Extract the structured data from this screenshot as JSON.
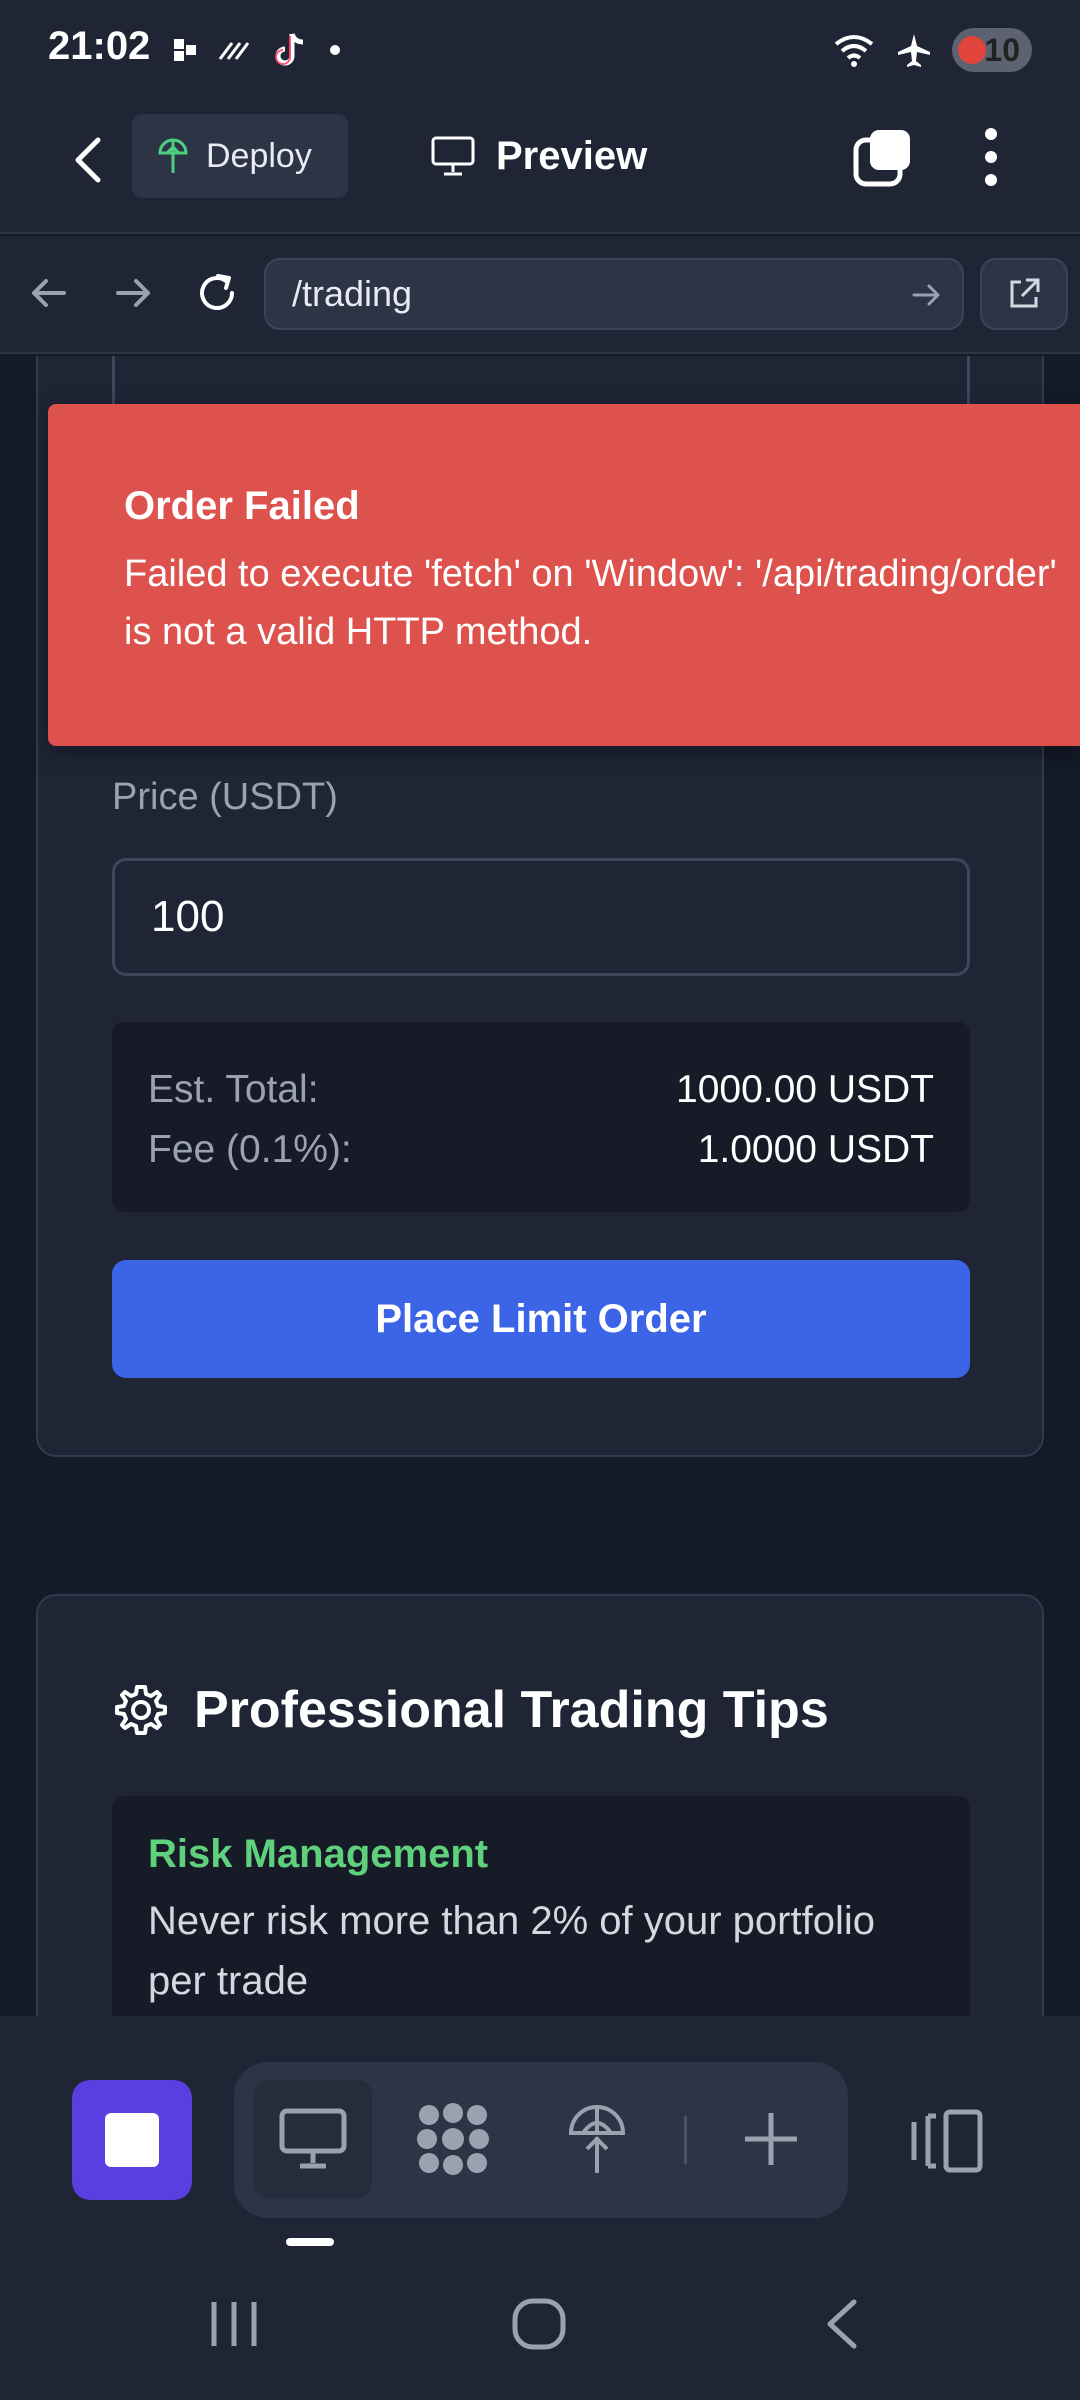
{
  "status_bar": {
    "time": "21:02",
    "battery": "10"
  },
  "header": {
    "deploy_label": "Deploy",
    "preview_label": "Preview"
  },
  "browser": {
    "url": "/trading"
  },
  "order_form": {
    "price_label": "Price (USDT)",
    "price_value": "100",
    "summary": [
      {
        "label": "Est. Total:",
        "value": "1000.00 USDT"
      },
      {
        "label": "Fee (0.1%):",
        "value": "1.0000 USDT"
      }
    ],
    "submit_label": "Place Limit Order"
  },
  "toast": {
    "title": "Order Failed",
    "message": "Failed to execute 'fetch' on 'Window': '/api/trading/order' is not a valid HTTP method."
  },
  "tips": {
    "title": "Professional Trading Tips",
    "items": [
      {
        "title": "Risk Management",
        "text": "Never risk more than 2% of your portfolio per trade"
      }
    ]
  },
  "colors": {
    "toast_bg": "#dd524c",
    "primary_button": "#3b64e6",
    "tip_title": "#5fd07b",
    "stop_button": "#5a3ee0"
  }
}
